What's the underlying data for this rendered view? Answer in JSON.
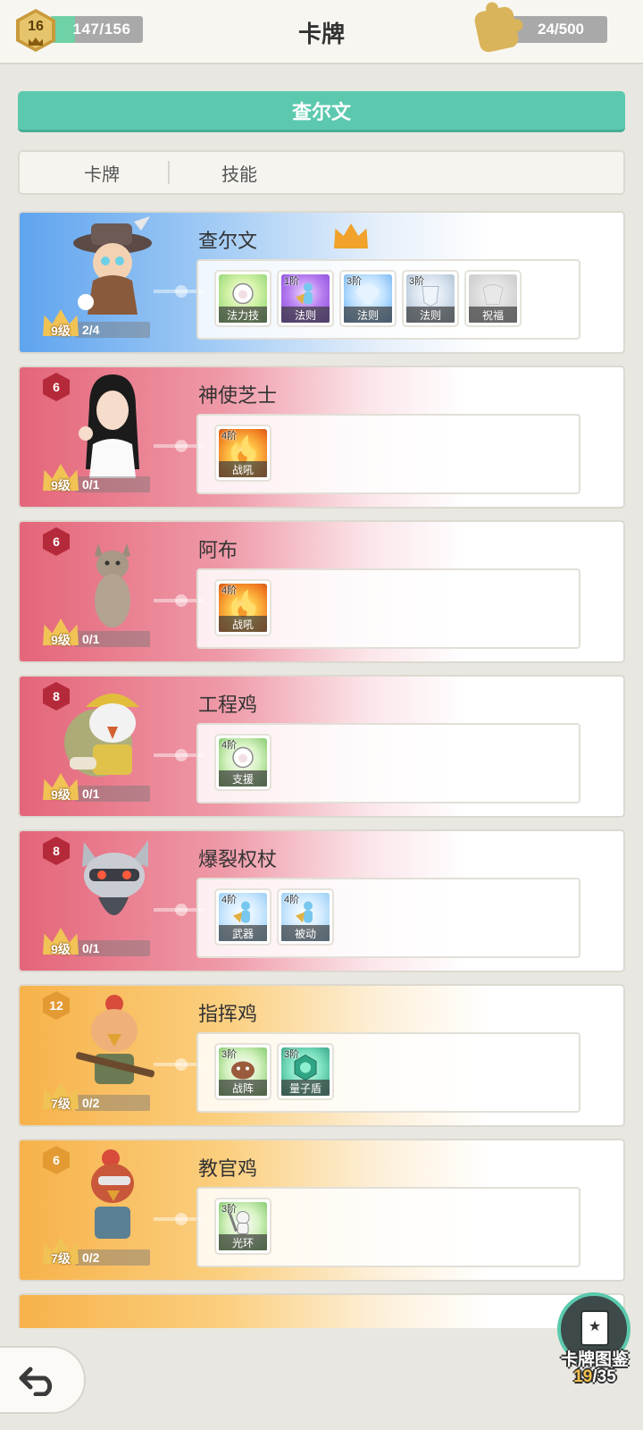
{
  "header": {
    "player_level": "16",
    "xp_text": "147/156",
    "xp_progress": 0.94,
    "title": "卡牌",
    "puzzle_text": "24/500"
  },
  "hero": {
    "name": "查尔文"
  },
  "tabs": [
    {
      "label": "卡牌"
    },
    {
      "label": "技能"
    }
  ],
  "cards": [
    {
      "name": "查尔文",
      "theme": "blue",
      "rarity": "",
      "level": "9级",
      "shards": "2/4",
      "has_crown": true,
      "portrait_icon": "steampunk-mage-portrait",
      "skills": [
        {
          "tier": "",
          "label": "法力技",
          "art": "green",
          "icon": "sheep-icon"
        },
        {
          "tier": "1阶",
          "label": "法则",
          "art": "purple",
          "icon": "figure-icon"
        },
        {
          "tier": "3阶",
          "label": "法则",
          "art": "sky",
          "icon": "orb-icon"
        },
        {
          "tier": "3阶",
          "label": "法则",
          "art": "steel",
          "icon": "shield-icon"
        },
        {
          "tier": "",
          "label": "祝福",
          "art": "grey",
          "icon": "emblem-icon"
        }
      ]
    },
    {
      "name": "神使芝士",
      "theme": "red",
      "rarity": "6",
      "level": "9级",
      "shards": "0/1",
      "has_crown": false,
      "portrait_icon": "girl-portrait",
      "skills": [
        {
          "tier": "4阶",
          "label": "战吼",
          "art": "fire",
          "icon": "flame-icon"
        }
      ]
    },
    {
      "name": "阿布",
      "theme": "red",
      "rarity": "6",
      "level": "9级",
      "shards": "0/1",
      "has_crown": false,
      "portrait_icon": "cat-portrait",
      "skills": [
        {
          "tier": "4阶",
          "label": "战吼",
          "art": "fire",
          "icon": "flame-icon"
        }
      ]
    },
    {
      "name": "工程鸡",
      "theme": "red",
      "rarity": "8",
      "level": "9级",
      "shards": "0/1",
      "has_crown": false,
      "portrait_icon": "engineer-chicken-portrait",
      "skills": [
        {
          "tier": "4阶",
          "label": "支援",
          "art": "lime",
          "icon": "sheep-icon"
        }
      ]
    },
    {
      "name": "爆裂权杖",
      "theme": "red",
      "rarity": "8",
      "level": "9级",
      "shards": "0/1",
      "has_crown": false,
      "portrait_icon": "robot-raccoon-portrait",
      "skills": [
        {
          "tier": "4阶",
          "label": "武器",
          "art": "ice",
          "icon": "figure-icon"
        },
        {
          "tier": "4阶",
          "label": "被动",
          "art": "ice",
          "icon": "figure-icon"
        }
      ]
    },
    {
      "name": "指挥鸡",
      "theme": "orange",
      "rarity": "12",
      "level": "7级",
      "shards": "0/2",
      "has_crown": false,
      "portrait_icon": "commander-chicken-portrait",
      "skills": [
        {
          "tier": "3阶",
          "label": "战阵",
          "art": "lime",
          "icon": "beast-icon"
        },
        {
          "tier": "3阶",
          "label": "量子盾",
          "art": "teal",
          "icon": "hex-shield-icon"
        }
      ]
    },
    {
      "name": "教官鸡",
      "theme": "orange",
      "rarity": "6",
      "level": "7级",
      "shards": "0/2",
      "has_crown": false,
      "portrait_icon": "instructor-chicken-portrait",
      "skills": [
        {
          "tier": "3阶",
          "label": "光环",
          "art": "lime",
          "icon": "knight-icon"
        }
      ]
    }
  ],
  "bottom": {
    "collection_label": "卡牌图鉴",
    "collection_current": "19",
    "collection_total": "/35"
  }
}
